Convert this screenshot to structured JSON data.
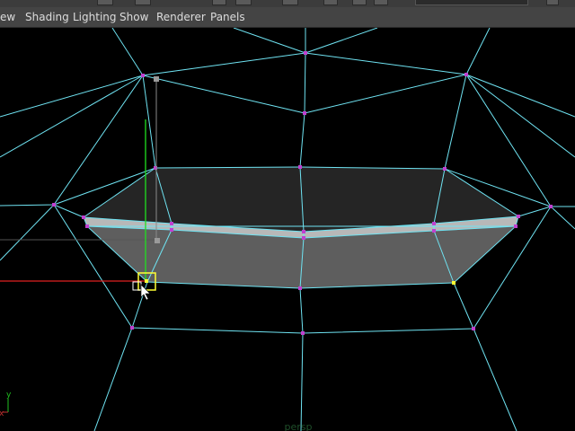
{
  "menubar": {
    "items": [
      "ew",
      "Shading",
      "Lighting",
      "Show",
      "Renderer",
      "Panels"
    ]
  },
  "viewport": {
    "camera_label": "persp",
    "axis_labels": {
      "y": "y",
      "x": "x"
    }
  },
  "colors": {
    "menubar_bg": "#444444",
    "menu_text": "#dcdcdc",
    "viewport_bg": "#000000",
    "wireframe": "#6fe3f2",
    "vertex": "#c040d0",
    "selected_vertex": "#ffff33",
    "manip_x": "#e02020",
    "manip_y": "#20e020",
    "face_gray": "#5a5a5a"
  },
  "icons": [
    "move-manipulator-icon",
    "mouse-cursor-icon",
    "view-axis-icon"
  ]
}
